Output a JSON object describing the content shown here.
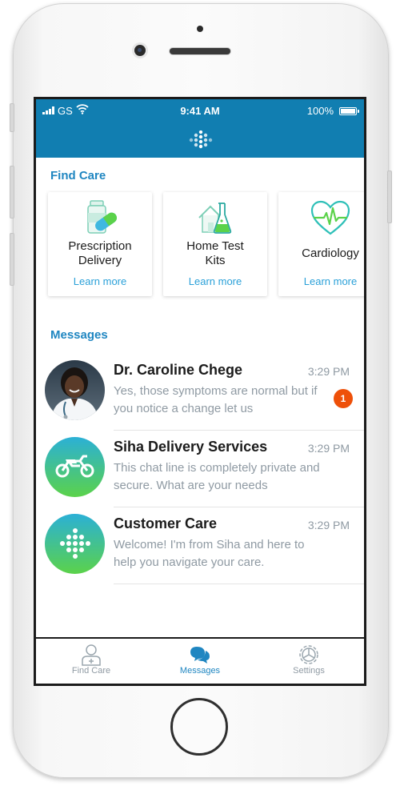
{
  "status_bar": {
    "carrier": "GS",
    "time": "9:41 AM",
    "battery": "100%"
  },
  "header": {
    "logo_icon": "siha-dots-logo-icon"
  },
  "find_care": {
    "title": "Find Care",
    "cards": [
      {
        "title": "Prescription Delivery",
        "line1": "Prescription",
        "line2": "Delivery",
        "link": "Learn more",
        "icon": "pill-bottle-icon"
      },
      {
        "title": "Home Test Kits",
        "line1": "Home Test",
        "line2": "Kits",
        "link": "Learn more",
        "icon": "home-flask-icon"
      },
      {
        "title": "Cardiology",
        "line1": "Cardiology",
        "line2": "",
        "link": "Learn more",
        "icon": "heart-pulse-icon"
      }
    ]
  },
  "messages": {
    "title": "Messages",
    "items": [
      {
        "name": "Dr. Caroline Chege",
        "time": "3:29 PM",
        "preview": "Yes, those symptoms are normal but if you notice a change let us",
        "badge": "1",
        "avatar": "doctor-photo"
      },
      {
        "name": "Siha Delivery Services",
        "time": "3:29 PM",
        "preview": "This chat line is completely private and secure. What are your needs",
        "avatar": "motorcycle-icon"
      },
      {
        "name": "Customer Care",
        "time": "3:29 PM",
        "preview": "Welcome! I'm from Siha and here to help you navigate your care.",
        "avatar": "siha-dots-icon"
      }
    ]
  },
  "tabbar": {
    "tabs": [
      {
        "label": "Find Care",
        "icon": "person-icon",
        "active": false
      },
      {
        "label": "Messages",
        "icon": "chat-bubbles-icon",
        "active": true
      },
      {
        "label": "Settings",
        "icon": "gear-icon",
        "active": false
      }
    ]
  },
  "colors": {
    "header_blue": "#117eb1",
    "link_blue": "#29a0d8",
    "badge_orange": "#ee5009",
    "gradient_top": "#2bb0d6",
    "gradient_bottom": "#5bd24a"
  }
}
